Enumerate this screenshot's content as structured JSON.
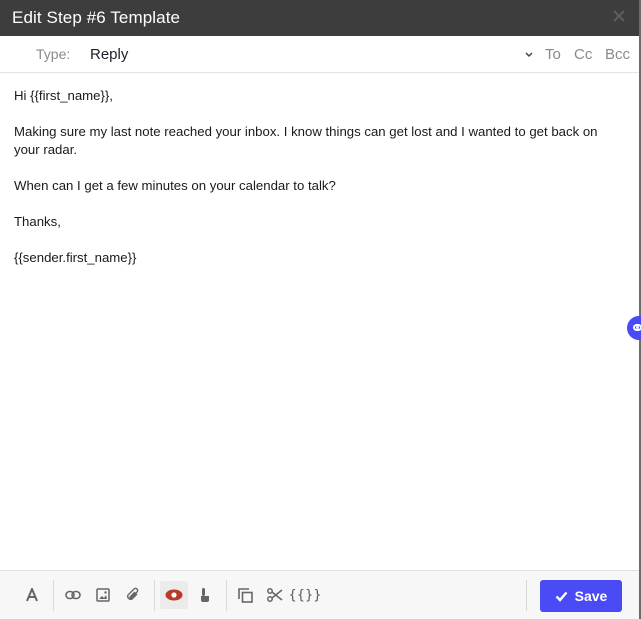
{
  "modal": {
    "title": "Edit Step #6 Template",
    "close_icon": "close-icon"
  },
  "type_row": {
    "label": "Type:",
    "value": "Reply",
    "recipients": [
      "To",
      "Cc",
      "Bcc"
    ]
  },
  "body": {
    "paragraphs": [
      "Hi {{first_name}},",
      "Making sure my last note reached your inbox. I know things can get lost and I wanted to get back on your radar.",
      "When can I get a few minutes on your calendar to talk?",
      "Thanks,",
      "{{sender.first_name}}"
    ]
  },
  "toolbar": {
    "tools": [
      {
        "name": "text-format",
        "icon": "font-icon"
      },
      {
        "name": "insert-link",
        "icon": "link-icon"
      },
      {
        "name": "insert-image",
        "icon": "image-icon"
      },
      {
        "name": "attach-file",
        "icon": "paperclip-icon"
      },
      {
        "name": "preview",
        "icon": "eye-icon",
        "active": true
      },
      {
        "name": "track-clicks",
        "icon": "pointer-icon"
      },
      {
        "name": "copy",
        "icon": "copy-icon"
      },
      {
        "name": "snippets",
        "icon": "scissors-icon"
      },
      {
        "name": "variables",
        "icon": "braces-icon",
        "label": "{{}}"
      }
    ],
    "save_label": "Save"
  },
  "colors": {
    "titlebar": "#3d3d3d",
    "accent": "#4b4bf5",
    "preview_active": "#b83a2a"
  }
}
